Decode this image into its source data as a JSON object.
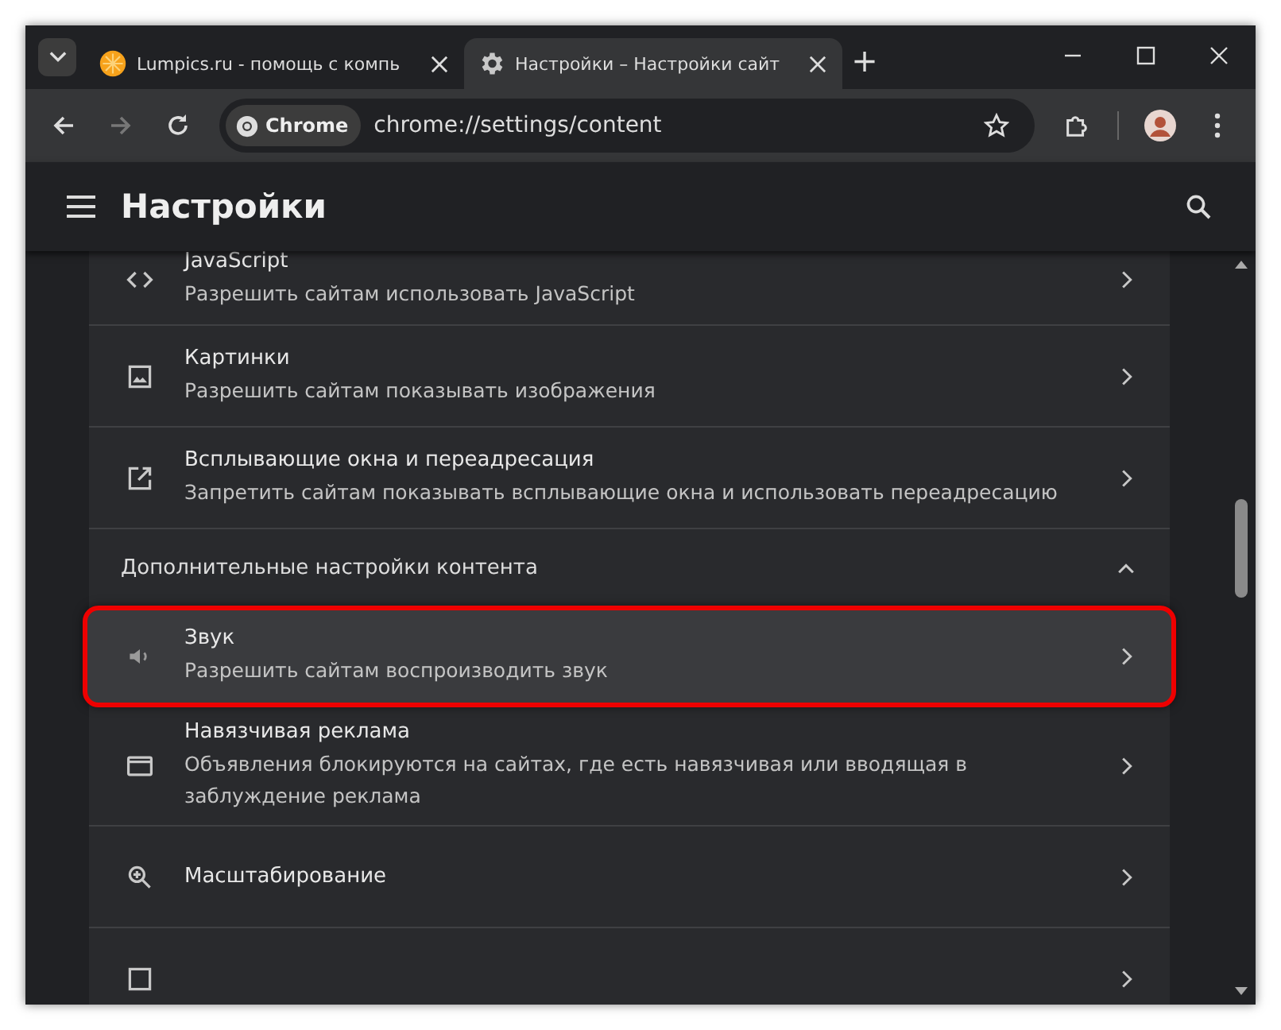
{
  "tabs": [
    {
      "title": "Lumpics.ru - помощь с компь",
      "selected": false
    },
    {
      "title": "Настройки – Настройки сайт",
      "selected": true
    }
  ],
  "tab_add": "+",
  "address_bar": {
    "chip": "Chrome",
    "url": "chrome://settings/content"
  },
  "page": {
    "title": "Настройки"
  },
  "items": [
    {
      "kind": "row",
      "title": "JavaScript",
      "subtitle": "Разрешить сайтам использовать JavaScript",
      "highlighted": false
    },
    {
      "kind": "row",
      "title": "Картинки",
      "subtitle": "Разрешить сайтам показывать изображения",
      "highlighted": false
    },
    {
      "kind": "row",
      "title": "Всплывающие окна и переадресация",
      "subtitle": "Запретить сайтам показывать всплывающие окна и использовать переадресацию",
      "highlighted": false
    },
    {
      "kind": "section",
      "title": "Дополнительные настройки контента",
      "expanded": true
    },
    {
      "kind": "row",
      "title": "Звук",
      "subtitle": "Разрешить сайтам воспроизводить звук",
      "highlighted": true
    },
    {
      "kind": "row",
      "title": "Навязчивая реклама",
      "subtitle": "Объявления блокируются на сайтах, где есть навязчивая или вводящая в заблуждение реклама",
      "highlighted": false
    },
    {
      "kind": "row",
      "title": "Масштабирование",
      "highlighted": false
    },
    {
      "kind": "row",
      "highlighted": false
    }
  ]
}
